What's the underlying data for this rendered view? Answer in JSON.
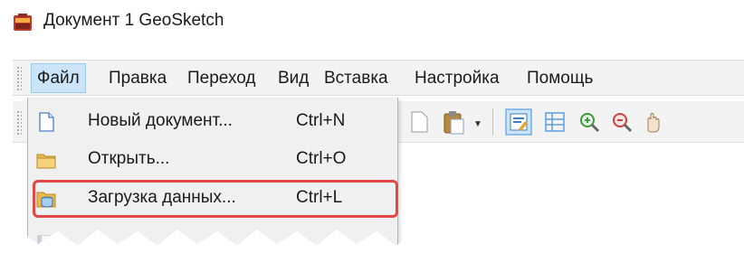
{
  "window": {
    "title": "Документ 1 GeoSketch",
    "icon": "geosketch-app-icon"
  },
  "menubar": {
    "items": [
      {
        "label": "Файл",
        "active": true
      },
      {
        "label": "Правка"
      },
      {
        "label": "Переход"
      },
      {
        "label": "Вид"
      },
      {
        "label": "Вставка"
      },
      {
        "label": "Настройка"
      },
      {
        "label": "Помощь"
      }
    ]
  },
  "toolbar": {
    "buttons": [
      {
        "icon": "page-icon"
      },
      {
        "icon": "paste-icon",
        "has_dropdown": true
      },
      {
        "icon": "edit-form-icon"
      },
      {
        "icon": "grid-lines-icon"
      },
      {
        "icon": "zoom-in-icon"
      },
      {
        "icon": "zoom-out-icon"
      },
      {
        "icon": "pan-icon"
      }
    ]
  },
  "file_menu": {
    "items": [
      {
        "icon": "new-document-icon",
        "label": "Новый документ...",
        "shortcut": "Ctrl+N"
      },
      {
        "icon": "open-folder-icon",
        "label": "Открыть...",
        "shortcut": "Ctrl+O"
      },
      {
        "icon": "load-data-icon",
        "label": "Загрузка данных...",
        "shortcut": "Ctrl+L",
        "highlighted": true
      },
      {
        "icon": "save-icon",
        "label": "",
        "shortcut": "",
        "cut_off": true
      }
    ]
  },
  "colors": {
    "highlight_border": "#e04848",
    "menu_active_bg": "#cce4f7",
    "menu_bg": "#f0f0f0",
    "bar_bg": "#f3f3f3"
  }
}
